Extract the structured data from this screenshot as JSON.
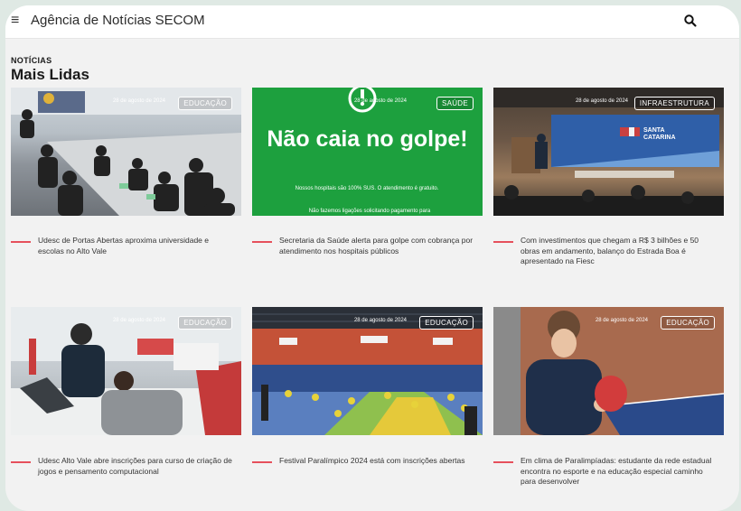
{
  "header": {
    "menu_glyph": "≡",
    "site_title": "Agência de Notícias SECOM",
    "search_icon": "search-icon"
  },
  "section": {
    "kicker": "NOTÍCIAS",
    "title": "Mais Lidas"
  },
  "colors": {
    "accent_dash": "#e6505c",
    "saude_green": "#1da03e"
  },
  "cards": [
    {
      "date": "28 de agosto de 2024",
      "category": "EDUCAÇÃO",
      "headline": "Udesc de Portas Abertas aproxima universidade e escolas no Alto Vale"
    },
    {
      "date": "28 de agosto de 2024",
      "category": "SAÚDE",
      "image_heading": "Não caia no golpe!",
      "image_text_1": "Nossos hospitais são 100% SUS. O atendimento é gratuito.",
      "image_text_2": "Não fazemos ligações solicitando pagamento para",
      "headline": "Secretaria da Saúde alerta para golpe com cobrança por atendimento nos hospitais públicos"
    },
    {
      "date": "28 de agosto de 2024",
      "category": "INFRAESTRUTURA",
      "screen_text": "SANTA CATARINA",
      "headline": "Com investimentos que chegam a R$ 3 bilhões e 50 obras em andamento, balanço do Estrada Boa é apresentado na Fiesc"
    },
    {
      "date": "28 de agosto de 2024",
      "category": "EDUCAÇÃO",
      "headline": "Udesc Alto Vale abre inscrições para curso de criação de jogos e pensamento computacional"
    },
    {
      "date": "28 de agosto de 2024",
      "category": "EDUCAÇÃO",
      "headline": "Festival Paralímpico 2024 está com inscrições abertas"
    },
    {
      "date": "28 de agosto de 2024",
      "category": "EDUCAÇÃO",
      "headline": "Em clima de Paralimpíadas: estudante da rede estadual encontra no esporte e na educação especial caminho para desenvolver"
    }
  ]
}
